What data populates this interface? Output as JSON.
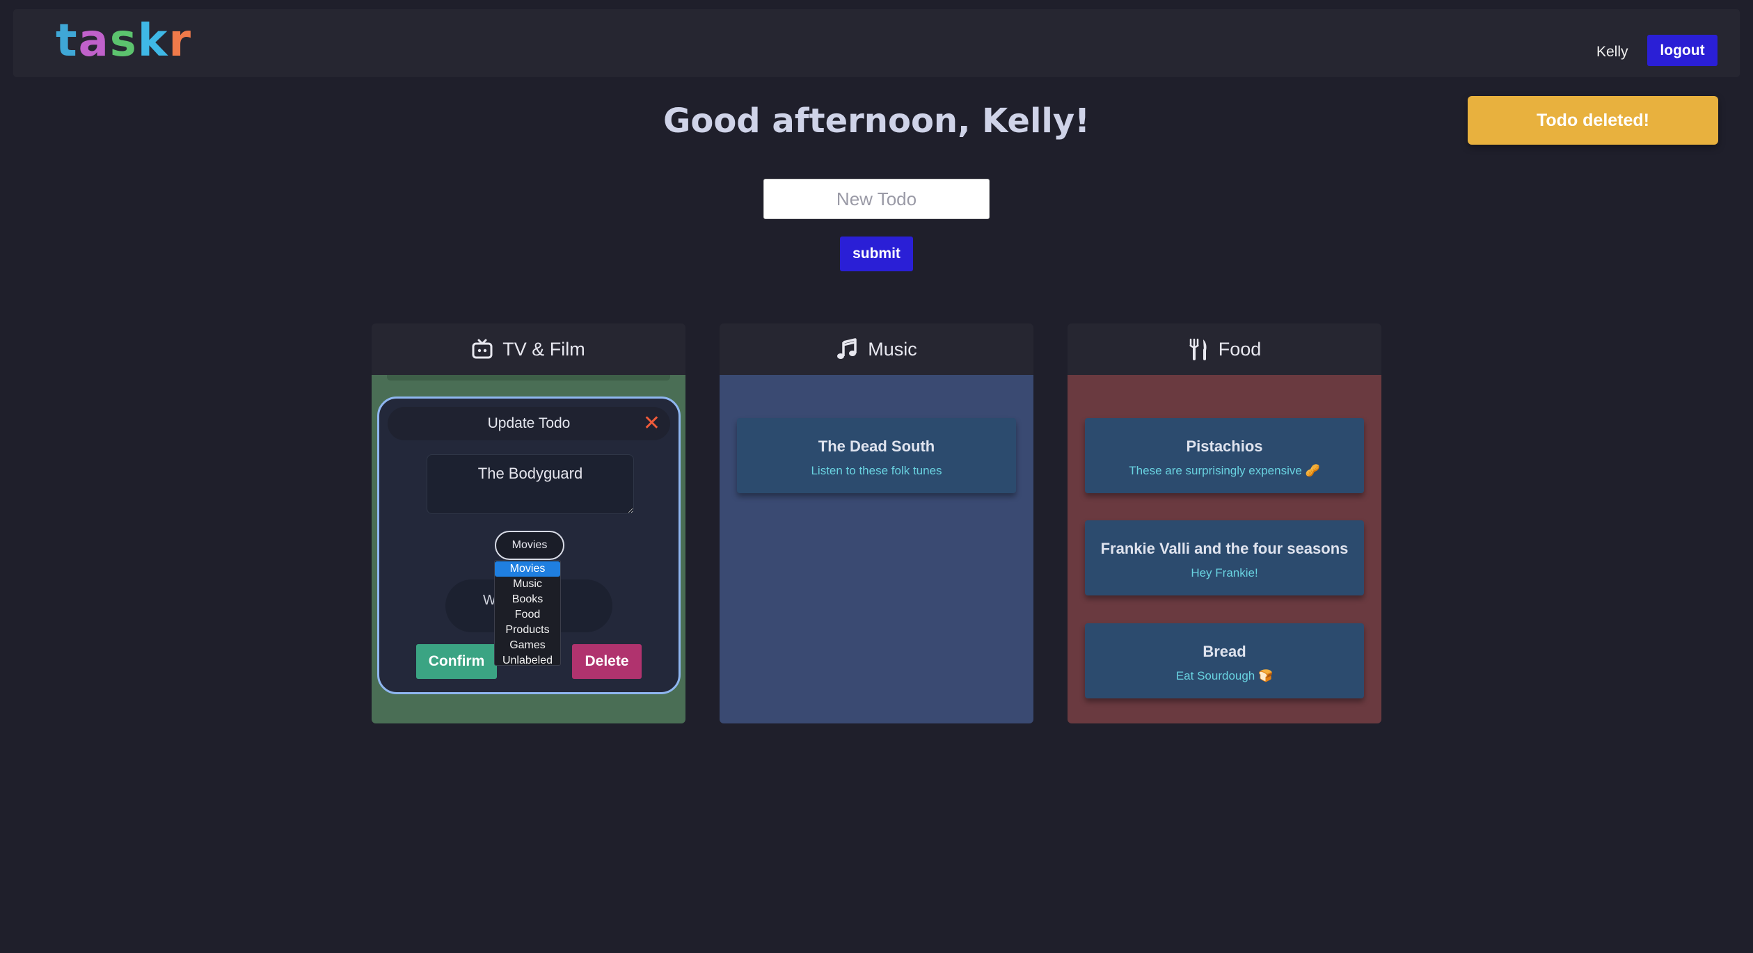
{
  "nav": {
    "logo_letters": [
      "t",
      "a",
      "s",
      "k",
      "r"
    ],
    "username": "Kelly",
    "logout_label": "logout"
  },
  "greeting": "Good afternoon, Kelly!",
  "toast": "Todo deleted!",
  "new_todo": {
    "placeholder": "New Todo",
    "value": ""
  },
  "submit_label": "submit",
  "columns": [
    {
      "title": "TV & Film",
      "icon": "tv-icon",
      "color": "#4a6e55"
    },
    {
      "title": "Music",
      "icon": "music-note-icon",
      "color": "#3a4a72",
      "cards": [
        {
          "title": "The Dead South",
          "desc": "Listen to these folk tunes"
        }
      ]
    },
    {
      "title": "Food",
      "icon": "utensils-icon",
      "color": "#6a3a40",
      "cards": [
        {
          "title": "Pistachios",
          "desc": "These are surprisingly expensive 🥜"
        },
        {
          "title": "Frankie Valli and the four seasons",
          "desc": "Hey Frankie!"
        },
        {
          "title": "Bread",
          "desc": "Eat Sourdough 🍞"
        }
      ]
    }
  ],
  "update_modal": {
    "title": "Update Todo",
    "close_icon": "close-icon",
    "todo_text": "The Bodyguard",
    "category_selected": "Movies",
    "ghost_field_text": "W          rm",
    "confirm_label": "Confirm",
    "delete_label": "Delete"
  },
  "category_options": [
    "Movies",
    "Music",
    "Books",
    "Food",
    "Products",
    "Games",
    "Unlabeled"
  ],
  "colors": {
    "accent": "#2a1fd6",
    "toast": "#e8b13e",
    "confirm": "#3ba483",
    "delete": "#b0336e"
  }
}
